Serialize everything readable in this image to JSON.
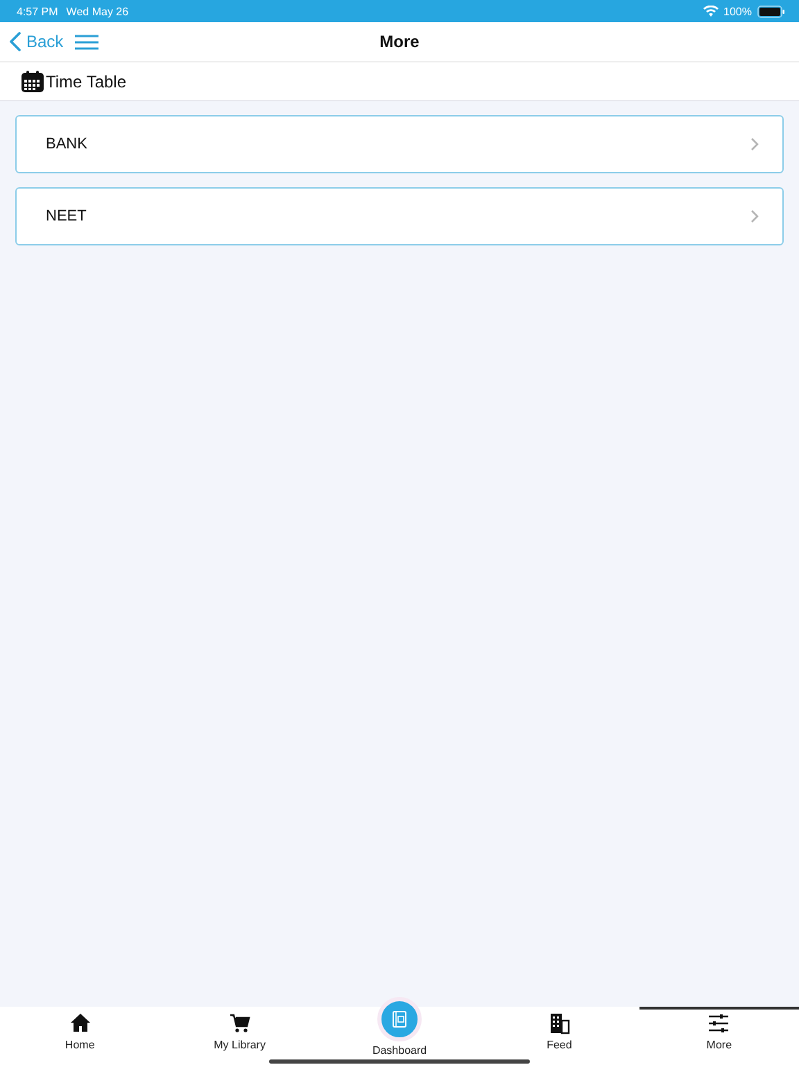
{
  "status_bar": {
    "time": "4:57 PM",
    "date": "Wed May 26",
    "battery": "100%"
  },
  "nav_bar": {
    "back": "Back",
    "title": "More"
  },
  "section": {
    "title": "Time Table"
  },
  "items": [
    {
      "label": "BANK"
    },
    {
      "label": "NEET"
    }
  ],
  "tab_bar": [
    {
      "label": "Home",
      "kind": "home",
      "selected": false
    },
    {
      "label": "My Library",
      "kind": "cart",
      "selected": false
    },
    {
      "label": "Dashboard",
      "kind": "book",
      "selected": false
    },
    {
      "label": "Feed",
      "kind": "building",
      "selected": false
    },
    {
      "label": "More",
      "kind": "sliders",
      "selected": true
    }
  ]
}
